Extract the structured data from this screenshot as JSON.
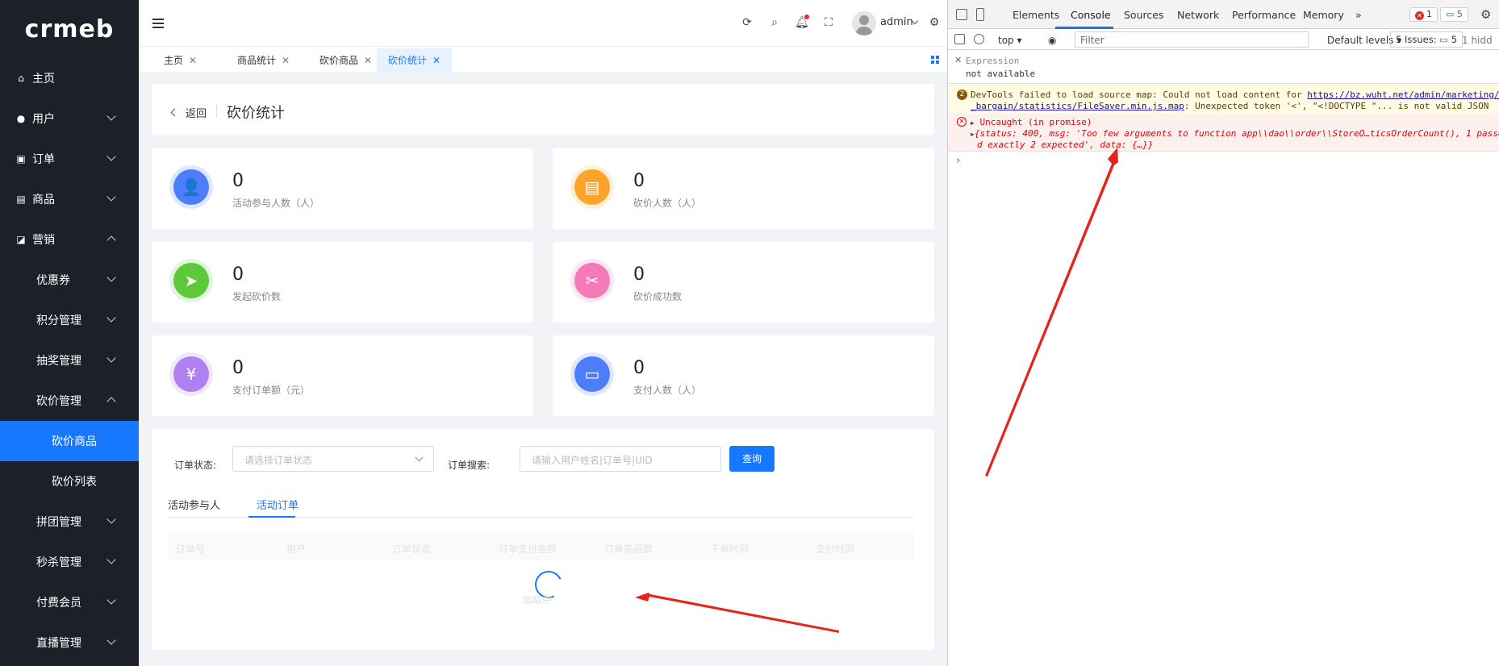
{
  "app": {
    "logo": "crmeb",
    "username": "admin"
  },
  "sidebar": {
    "items": [
      {
        "label": "主页",
        "icon": "home-icon",
        "glyph": "⌂"
      },
      {
        "label": "用户",
        "icon": "user-icon",
        "glyph": "●"
      },
      {
        "label": "订单",
        "icon": "order-icon",
        "glyph": "▣"
      },
      {
        "label": "商品",
        "icon": "goods-icon",
        "glyph": "▤"
      },
      {
        "label": "营销",
        "icon": "marketing-icon",
        "glyph": "◪"
      }
    ],
    "sub_items": [
      "优惠券",
      "积分管理",
      "抽奖管理",
      "砍价管理"
    ],
    "subsub_items": [
      "砍价商品",
      "砍价列表"
    ],
    "more_items": [
      "拼团管理",
      "秒杀管理",
      "付费会员",
      "直播管理"
    ]
  },
  "tabs": [
    {
      "label": "主页"
    },
    {
      "label": "商品统计"
    },
    {
      "label": "砍价商品"
    },
    {
      "label": "砍价统计",
      "active": true
    }
  ],
  "page": {
    "back": "返回",
    "title": "砍价统计"
  },
  "stats": [
    {
      "value": "0",
      "label": "活动参与人数（人）",
      "color": "#4e7dfa",
      "ring": "#dfe8fe",
      "glyph": "👤",
      "icon": "user-icon"
    },
    {
      "value": "0",
      "label": "砍价人数（人）",
      "color": "#faa42a",
      "ring": "#fff0d9",
      "glyph": "▤",
      "icon": "clipboard-icon"
    },
    {
      "value": "0",
      "label": "发起砍价数",
      "color": "#5cc93b",
      "ring": "#e2f6dc",
      "glyph": "➤",
      "icon": "paper-plane-icon"
    },
    {
      "value": "0",
      "label": "砍价成功数",
      "color": "#f57ab8",
      "ring": "#fde5f1",
      "glyph": "✂",
      "icon": "ticket-icon"
    },
    {
      "value": "0",
      "label": "支付订单额（元）",
      "color": "#b07ff0",
      "ring": "#f0e6fd",
      "glyph": "¥",
      "icon": "money-bag-icon"
    },
    {
      "value": "0",
      "label": "支付人数（人）",
      "color": "#4e7dfa",
      "ring": "#dfe8fe",
      "glyph": "▭",
      "icon": "wallet-icon"
    }
  ],
  "filter": {
    "status_label": "订单状态:",
    "status_placeholder": "请选择订单状态",
    "search_label": "订单搜索:",
    "search_placeholder": "请输入用户姓名|订单号|UID",
    "query_button": "查询"
  },
  "subtabs": [
    "活动参与人",
    "活动订单"
  ],
  "table": {
    "columns": [
      "订单号",
      "用户",
      "订单状态",
      "订单支付金额",
      "订单商品数",
      "下单时间",
      "支付时间"
    ],
    "loading_text": "加载中"
  },
  "devtools": {
    "tabs": [
      "Elements",
      "Console",
      "Sources",
      "Network",
      "Performance",
      "Memory"
    ],
    "errors_count": "1",
    "messages_count": "5",
    "context": "top",
    "filter_placeholder": "Filter",
    "levels": "Default levels",
    "issues_label": "5 Issues:",
    "issues_count": "5",
    "hidden": "1 hidd",
    "expression_label": "Expression",
    "expression_value": "not available",
    "warn_count": "2",
    "warn_text_a": "DevTools failed to load source map: Could not load content for ",
    "warn_link": "https://bz.wuht.net/admin/marketing/",
    "warn_link2": "_bargain/statistics/FileSaver.min.js.map",
    "warn_text_b": ": Unexpected token '<', \"<!DOCTYPE \"... is not valid JSON",
    "err_title": "Uncaught (in promise)",
    "err_line1": "{status: 400, msg: 'Too few arguments to function app\\\\dao\\\\order\\\\StoreO…ticsOrderCount(), 1 passe",
    "err_line2": "d exactly 2 expected', data: {…}}",
    "prompt": "›"
  },
  "colors": {
    "sidebar_bg": "#1b2029",
    "accent": "#1677ff",
    "annotation": "#e8231a"
  }
}
